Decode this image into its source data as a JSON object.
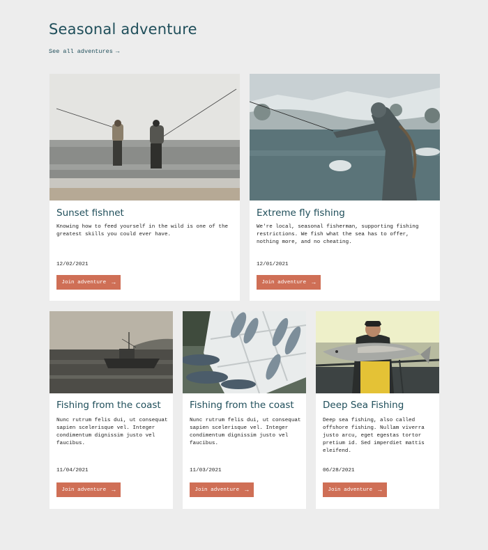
{
  "page": {
    "title": "Seasonal adventure",
    "see_all_label": "See all adventures"
  },
  "colors": {
    "background": "#ededed",
    "title": "#1f4e5a",
    "button": "#cf6f56",
    "card": "#ffffff"
  },
  "cards": [
    {
      "image": "anglers-wading-surf-photo",
      "title": "Sunset fishnet",
      "description": "Knowing how to feed yourself in the wild is one of the greatest skills you could ever have.",
      "date": "12/02/2021",
      "button": "Join adventure"
    },
    {
      "image": "fly-fisher-snowy-river-photo",
      "title": "Extreme fly fishing",
      "description": "We're local, seasonal fisherman, supporting fishing restrictions. We fish what the sea has to offer, nothing more, and no cheating.",
      "date": "12/01/2021",
      "button": "Join adventure"
    },
    {
      "image": "fishing-boat-at-sea-photo",
      "title": "Fishing from the coast",
      "description": "Nunc rutrum felis dui, ut consequat sapien scelerisque vel. Integer condimentum dignissim justo vel faucibus.",
      "date": "11/04/2021",
      "button": "Join adventure"
    },
    {
      "image": "fish-on-ice-crates-photo",
      "title": "Fishing from the coast",
      "description": "Nunc rutrum felis dui, ut consequat sapien scelerisque vel. Integer condimentum dignissim justo vel faucibus.",
      "date": "11/03/2021",
      "button": "Join adventure"
    },
    {
      "image": "fisherman-holding-salmon-photo",
      "title": "Deep Sea Fishing",
      "description": "Deep sea fishing, also called offshore fishing. Nullam viverra justo arcu, eget egestas tortor pretium id. Sed imperdiet mattis eleifend.",
      "date": "06/28/2021",
      "button": "Join adventure"
    }
  ]
}
